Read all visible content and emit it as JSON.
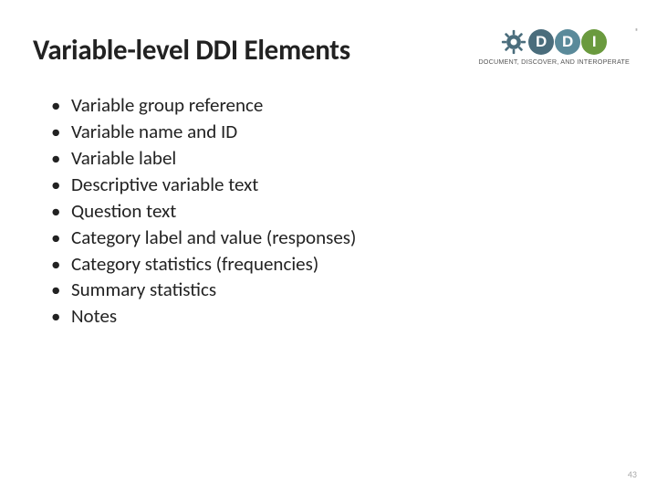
{
  "title": "Variable-level DDI Elements",
  "logo": {
    "letters": {
      "d1": "D",
      "d2": "D",
      "i": "I"
    },
    "reg": "®",
    "tagline": "DOCUMENT, DISCOVER, AND INTEROPERATE"
  },
  "bullets": [
    "Variable group reference",
    "Variable name and ID",
    "Variable label",
    "Descriptive variable text",
    "Question text",
    "Category label and value (responses)",
    "Category statistics (frequencies)",
    "Summary statistics",
    "Notes"
  ],
  "page_number": "43"
}
